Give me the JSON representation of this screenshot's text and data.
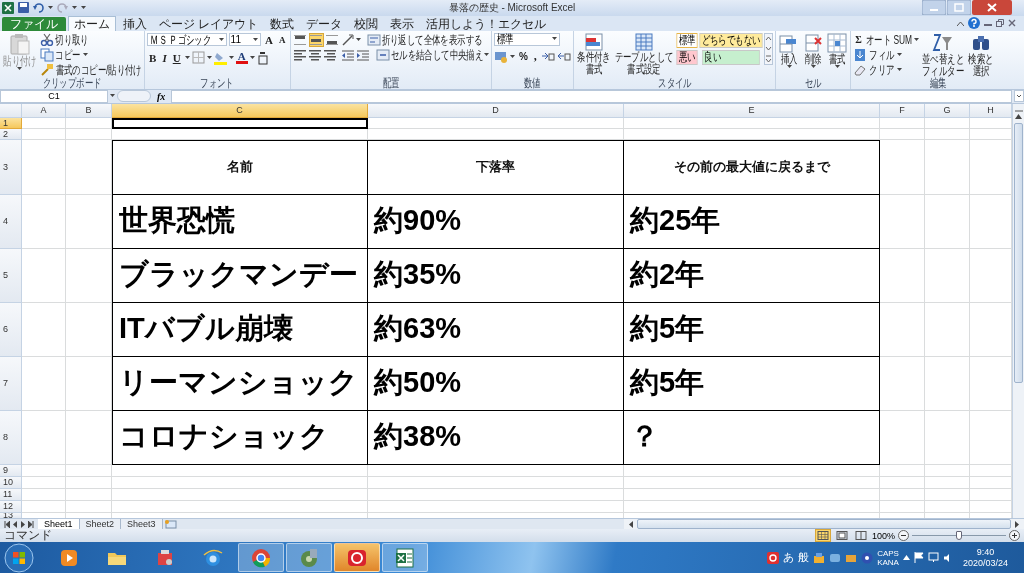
{
  "window": {
    "title": "暴落の歴史 - Microsoft Excel"
  },
  "ribbon_tabs": [
    {
      "label": "ファイル",
      "kind": "file",
      "selected": false
    },
    {
      "label": "ホーム",
      "kind": "tab",
      "selected": true
    },
    {
      "label": "挿入",
      "kind": "tab",
      "selected": false
    },
    {
      "label": "ページ レイアウト",
      "kind": "tab",
      "selected": false
    },
    {
      "label": "数式",
      "kind": "tab",
      "selected": false
    },
    {
      "label": "データ",
      "kind": "tab",
      "selected": false
    },
    {
      "label": "校閲",
      "kind": "tab",
      "selected": false
    },
    {
      "label": "表示",
      "kind": "tab",
      "selected": false
    },
    {
      "label": "活用しよう！エクセル",
      "kind": "tab",
      "selected": false
    }
  ],
  "ribbon": {
    "clipboard": {
      "group_label": "クリップボード",
      "paste": "貼り付け",
      "cut": "切り取り",
      "copy": "コピー",
      "format_painter": "書式のコピー/貼り付け"
    },
    "font": {
      "group_label": "フォント",
      "font_name": "ＭＳ Ｐゴシック",
      "font_size": "11",
      "grow": "A",
      "shrink": "A",
      "bold": "B",
      "italic": "I",
      "underline": "U",
      "color_letter": "A"
    },
    "alignment": {
      "group_label": "配置",
      "vertical": [
        {
          "selected": false
        },
        {
          "selected": true
        },
        {
          "selected": false
        }
      ],
      "wrap": "折り返して全体を表示する",
      "merge": "セルを結合して中央揃え"
    },
    "number": {
      "group_label": "数値",
      "format": "標準",
      "percent": "%",
      "comma": ","
    },
    "styles": {
      "group_label": "スタイル",
      "conditional": [
        "条件付き",
        "書式"
      ],
      "table": [
        "テーブルとして",
        "書式設定"
      ],
      "cell_styles": [
        {
          "label": "標準",
          "color": "#ffffff"
        },
        {
          "label": "どちらでもない",
          "color": "#ffeb9c"
        },
        {
          "label": "悪い",
          "color": "#ffc7ce"
        },
        {
          "label": "良い",
          "color": "#c6efce"
        }
      ]
    },
    "cells": {
      "group_label": "セル",
      "buttons": [
        "挿入",
        "削除",
        "書式"
      ]
    },
    "editing": {
      "group_label": "編集",
      "sigma": "Σ",
      "autosum": "オート SUM",
      "fill": "フィル",
      "clear": "クリア",
      "sort": [
        "並べ替えと",
        "フィルター"
      ],
      "find": [
        "検索と",
        "選択"
      ]
    }
  },
  "formula_bar": {
    "name_box": "C1",
    "fx": "fx"
  },
  "sheet": {
    "columns": [
      {
        "label": "A",
        "selected": false
      },
      {
        "label": "B",
        "selected": false
      },
      {
        "label": "C",
        "selected": true
      },
      {
        "label": "D",
        "selected": false
      },
      {
        "label": "E",
        "selected": false
      },
      {
        "label": "F",
        "selected": false
      },
      {
        "label": "G",
        "selected": false
      },
      {
        "label": "H",
        "selected": false
      }
    ],
    "rows": [
      {
        "label": "1",
        "selected": true
      },
      {
        "label": "2",
        "selected": false
      },
      {
        "label": "3",
        "selected": false
      },
      {
        "label": "4",
        "selected": false
      },
      {
        "label": "5",
        "selected": false
      },
      {
        "label": "6",
        "selected": false
      },
      {
        "label": "7",
        "selected": false
      },
      {
        "label": "8",
        "selected": false
      },
      {
        "label": "9",
        "selected": false
      },
      {
        "label": "10",
        "selected": false
      },
      {
        "label": "11",
        "selected": false
      },
      {
        "label": "12",
        "selected": false
      },
      {
        "label": "13",
        "selected": false
      }
    ],
    "table": {
      "header": [
        "名前",
        "下落率",
        "その前の最大値に戻るまで"
      ],
      "rows": [
        [
          "世界恐慌",
          "約90%",
          "約25年"
        ],
        [
          "ブラックマンデー",
          "約35%",
          "約2年"
        ],
        [
          "ITバブル崩壊",
          "約63%",
          "約5年"
        ],
        [
          "リーマンショック",
          "約50%",
          "約5年"
        ],
        [
          "コロナショック",
          "約38%",
          "？"
        ]
      ]
    }
  },
  "sheet_tabs": [
    {
      "label": "Sheet1",
      "selected": true
    },
    {
      "label": "Sheet2",
      "selected": false
    },
    {
      "label": "Sheet3",
      "selected": false
    }
  ],
  "status_bar": {
    "mode": "コマンド",
    "views": [
      {
        "selected": true
      },
      {
        "selected": false
      },
      {
        "selected": false
      }
    ],
    "zoom": "100%",
    "zoom_level": {
      "level": 0.5
    }
  },
  "taskbar": {
    "ime": [
      "あ",
      "般"
    ],
    "caps": "CAPS",
    "kana": "KANA",
    "time": "9:40",
    "date": "2020/03/24"
  }
}
